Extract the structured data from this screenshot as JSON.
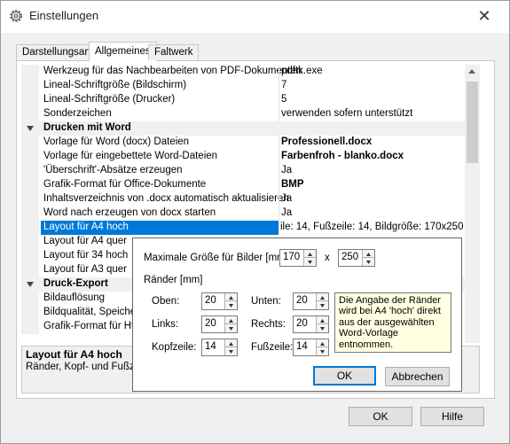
{
  "window": {
    "title": "Einstellungen",
    "icon": "gear-icon",
    "close_glyph": "✕"
  },
  "tabs": [
    {
      "label": "Darstellungsart",
      "active": false
    },
    {
      "label": "Allgemeines",
      "active": true
    },
    {
      "label": "Faltwerk",
      "active": false
    }
  ],
  "grid": {
    "rows": [
      {
        "name": "Werkzeug für das Nachbearbeiten von PDF-Dokumenten",
        "value": "pdftk.exe"
      },
      {
        "name": "Lineal-Schriftgröße (Bildschirm)",
        "value": "7"
      },
      {
        "name": "Lineal-Schriftgröße (Drucker)",
        "value": "5"
      },
      {
        "name": "Sonderzeichen",
        "value": "verwenden sofern unterstützt"
      },
      {
        "name": "Drucken mit Word",
        "category": true
      },
      {
        "name": "Vorlage für Word (docx) Dateien",
        "value": "Professionell.docx",
        "bold": true
      },
      {
        "name": "Vorlage für eingebettete Word-Dateien",
        "value": "Farbenfroh - blanko.docx",
        "bold": true
      },
      {
        "name": "'Überschrift'-Absätze erzeugen",
        "value": "Ja"
      },
      {
        "name": "Grafik-Format für Office-Dokumente",
        "value": "BMP",
        "bold": true
      },
      {
        "name": "Inhaltsverzeichnis von .docx automatisch aktualisieren",
        "value": "Ja"
      },
      {
        "name": "Word nach erzeugen von docx starten",
        "value": "Ja"
      },
      {
        "name": "Layout für A4 hoch",
        "value": "ile: 14, Fußzeile: 14, Bildgröße: 170x250",
        "selected": true
      },
      {
        "name": "Layout für A4 quer",
        "value": ""
      },
      {
        "name": "Layout für 34 hoch",
        "value": ""
      },
      {
        "name": "Layout für A3 quer",
        "value": ""
      },
      {
        "name": "Druck-Export",
        "category": true
      },
      {
        "name": "Bildauflösung",
        "value": ""
      },
      {
        "name": "Bildqualität, Speicher",
        "value": ""
      },
      {
        "name": "Grafik-Format für Htm",
        "value": ""
      }
    ]
  },
  "description": {
    "title": "Layout für A4 hoch",
    "text": "Ränder, Kopf- und Fußze"
  },
  "popup": {
    "max_size_label": "Maximale Größe für Bilder [mm]",
    "width": "170",
    "x_label": "x",
    "height": "250",
    "margins_label": "Ränder [mm]",
    "top_label": "Oben:",
    "top": "20",
    "bottom_label": "Unten:",
    "bottom": "20",
    "left_label": "Links:",
    "left": "20",
    "right_label": "Rechts:",
    "right": "20",
    "header_label": "Kopfzeile:",
    "header": "14",
    "footer_label": "Fußzeile:",
    "footer": "14",
    "tooltip": "Die Angabe der Ränder wird bei A4 'hoch' direkt aus der ausgewählten Word-Vorlage entnommen.",
    "ok_label": "OK",
    "cancel_label": "Abbrechen"
  },
  "footer": {
    "ok_label": "OK",
    "help_label": "Hilfe"
  },
  "colors": {
    "selection": "#0078d7",
    "tooltip_bg": "#ffffe1"
  }
}
